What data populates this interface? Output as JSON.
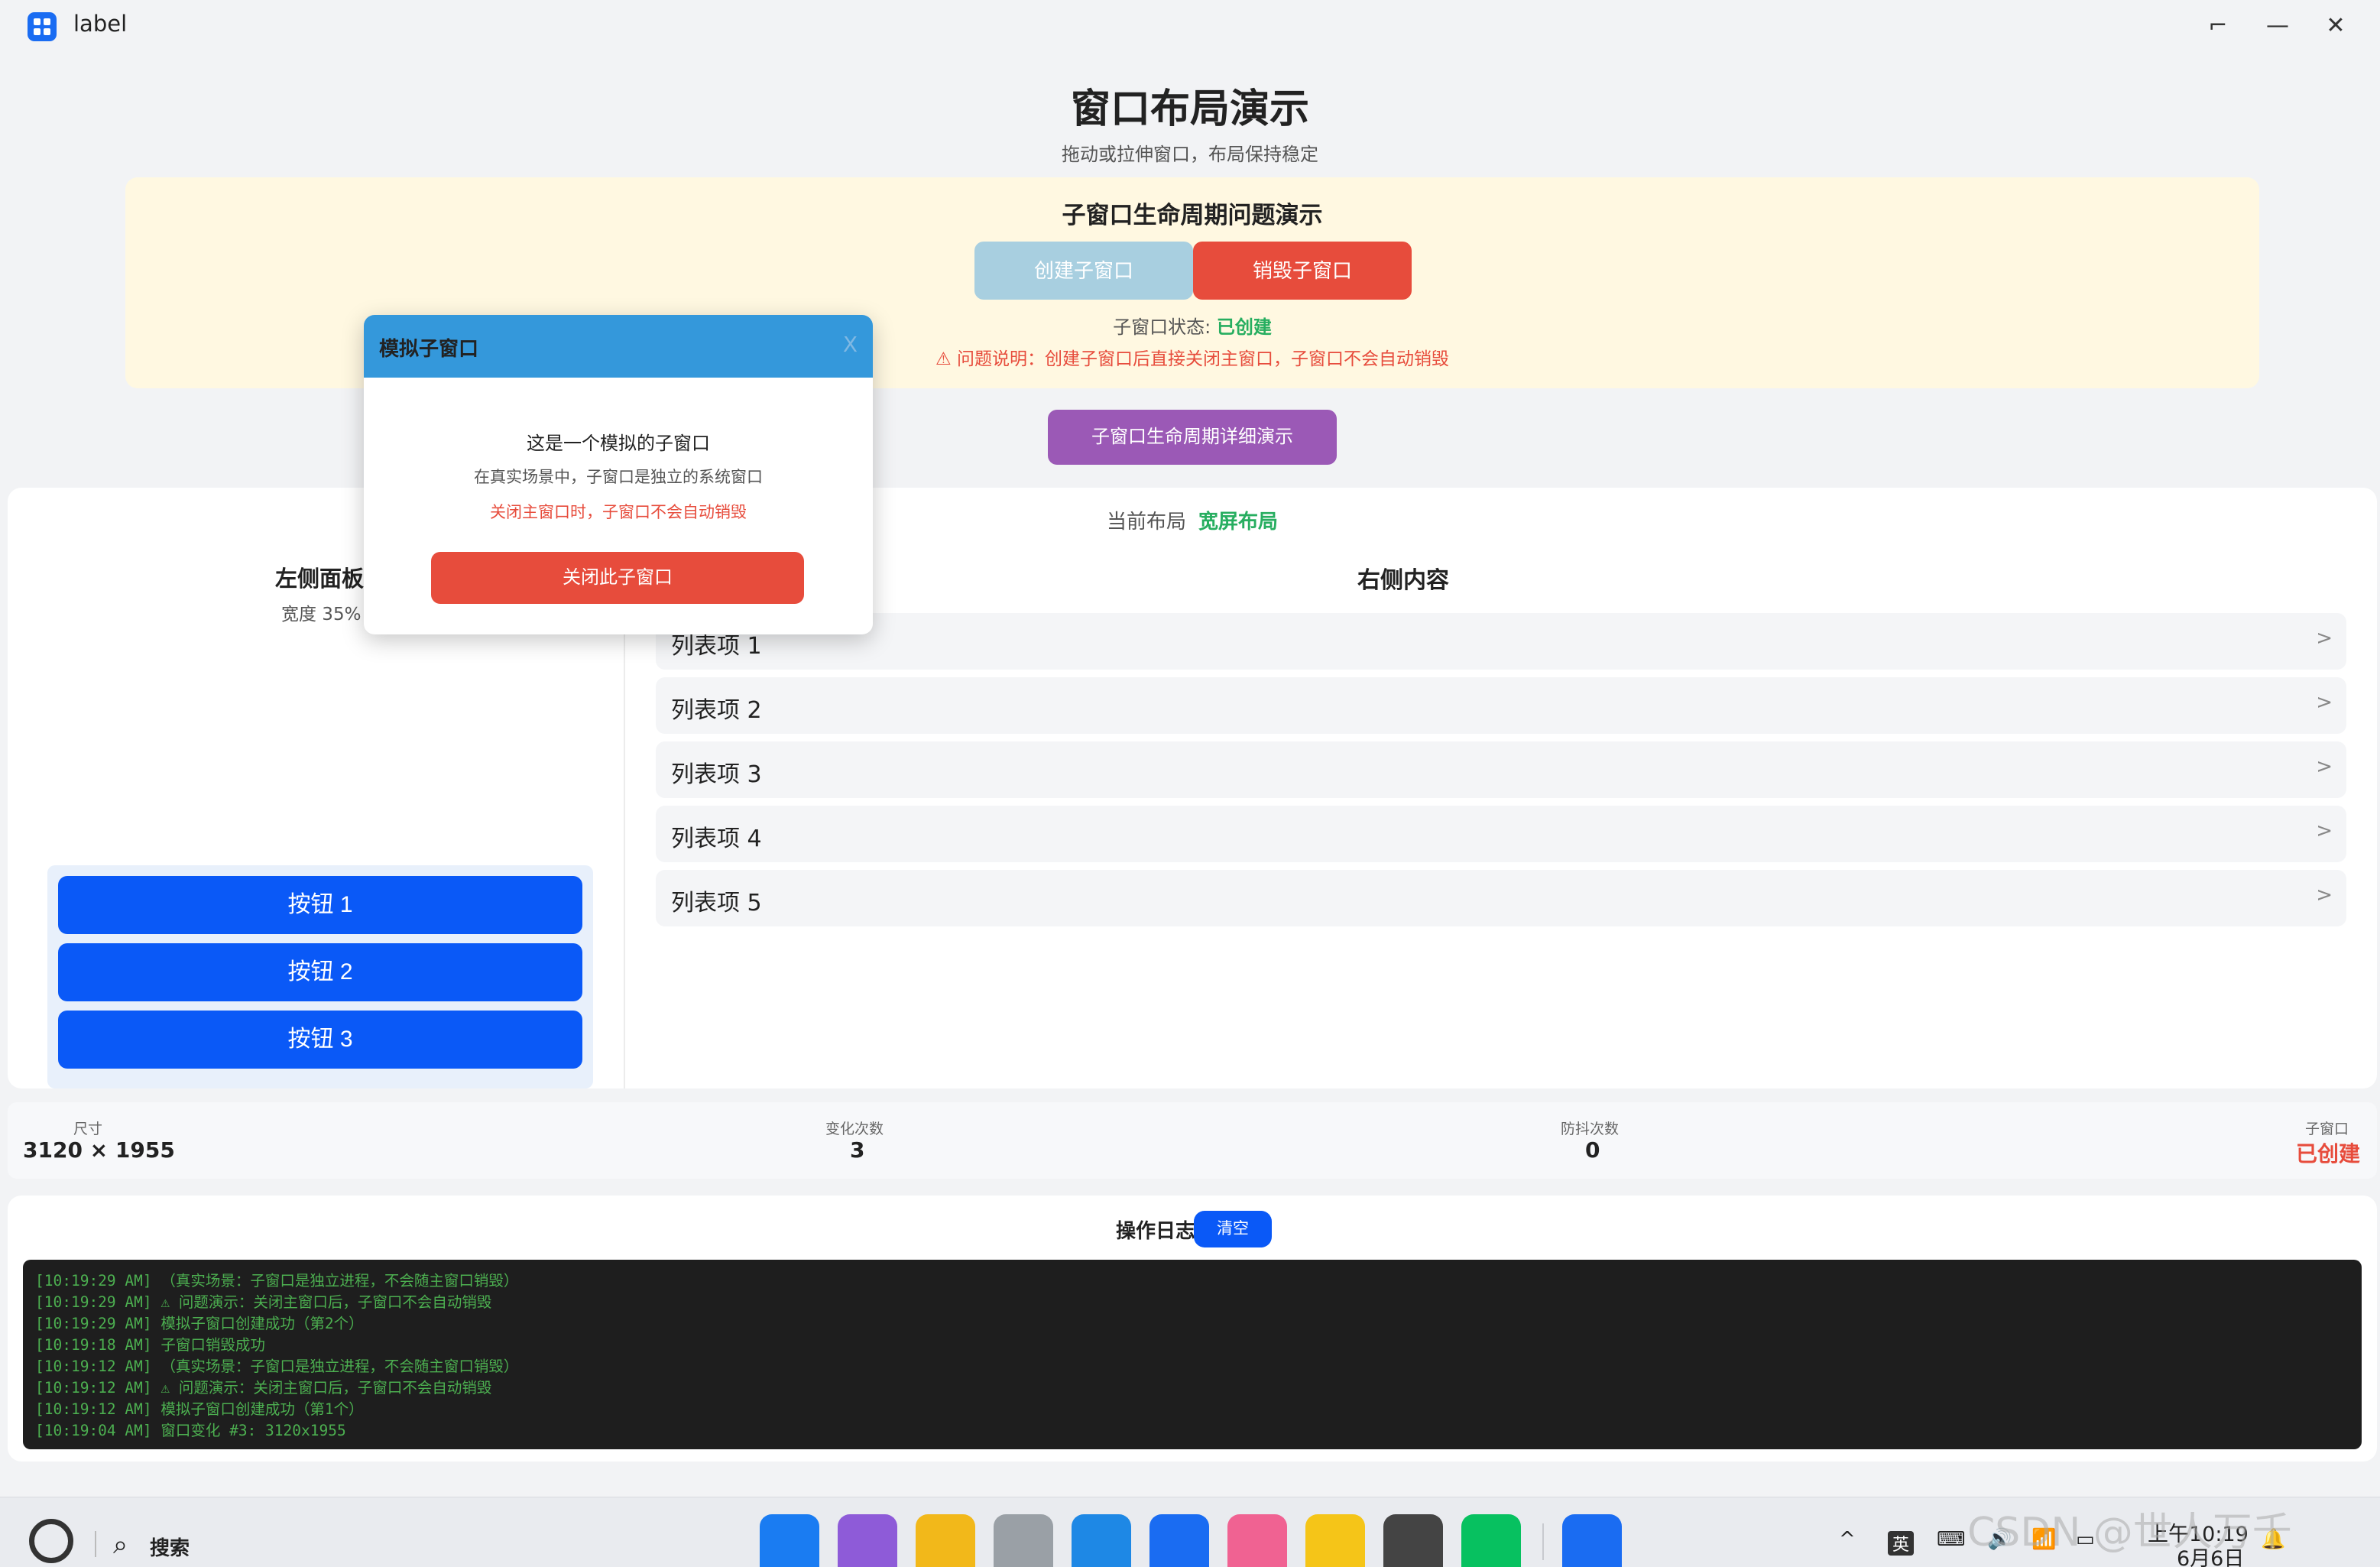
{
  "window": {
    "title": "label",
    "controls": {
      "restore": "⌐",
      "minimize": "—",
      "close": "✕"
    }
  },
  "header": {
    "title": "窗口布局演示",
    "subtitle": "拖动或拉伸窗口，布局保持稳定"
  },
  "lifecycle": {
    "title": "子窗口生命周期问题演示",
    "create_label": "创建子窗口",
    "destroy_label": "销毁子窗口",
    "status_prefix": "子窗口状态: ",
    "status_value": "已创建",
    "warning": "⚠ 问题说明：创建子窗口后直接关闭主窗口，子窗口不会自动销毁"
  },
  "detail_button": "子窗口生命周期详细演示",
  "layout": {
    "label": "当前布局",
    "value": "宽屏布局"
  },
  "left_panel": {
    "title": "左侧面板",
    "width": "宽度 35%",
    "buttons": [
      "按钮 1",
      "按钮 2",
      "按钮 3"
    ]
  },
  "right_panel": {
    "title": "右侧内容",
    "items": [
      "列表项 1",
      "列表项 2",
      "列表项 3",
      "列表项 4",
      "列表项 5"
    ],
    "chevron": ">"
  },
  "stats": {
    "size_label": "尺寸",
    "size_value": "3120 × 1955",
    "changes_label": "变化次数",
    "changes_value": "3",
    "debounce_label": "防抖次数",
    "debounce_value": "0",
    "child_label": "子窗口",
    "child_value": "已创建"
  },
  "log": {
    "title": "操作日志",
    "clear_label": "清空",
    "lines": [
      "[10:19:29 AM] （真实场景：子窗口是独立进程，不会随主窗口销毁）",
      "[10:19:29 AM] ⚠ 问题演示：关闭主窗口后，子窗口不会自动销毁",
      "[10:19:29 AM] 模拟子窗口创建成功（第2个）",
      "[10:19:18 AM] 子窗口销毁成功",
      "[10:19:12 AM] （真实场景：子窗口是独立进程，不会随主窗口销毁）",
      "[10:19:12 AM] ⚠ 问题演示：关闭主窗口后，子窗口不会自动销毁",
      "[10:19:12 AM] 模拟子窗口创建成功（第1个）",
      "[10:19:04 AM] 窗口变化 #3: 3120x1955"
    ]
  },
  "popup": {
    "title": "模拟子窗口",
    "close_x": "X",
    "line1": "这是一个模拟的子窗口",
    "line2": "在真实场景中，子窗口是独立的系统窗口",
    "line3": "关闭主窗口时，子窗口不会自动销毁",
    "close_button": "关闭此子窗口"
  },
  "taskbar": {
    "search": "搜索",
    "search_icon": "search-icon",
    "dock": [
      {
        "name": "app-grid",
        "color": "#1a7cf2"
      },
      {
        "name": "gallery",
        "color": "#8e5bd8"
      },
      {
        "name": "files",
        "color": "#f2b81a"
      },
      {
        "name": "recycle-bin",
        "color": "#9aa0a6"
      },
      {
        "name": "browser",
        "color": "#1e88e5"
      },
      {
        "name": "mail",
        "color": "#1a6cf2"
      },
      {
        "name": "photos",
        "color": "#f06292"
      },
      {
        "name": "notes",
        "color": "#f5c518"
      },
      {
        "name": "settings",
        "color": "#444444"
      },
      {
        "name": "wechat",
        "color": "#07c160"
      },
      {
        "name": "label-app",
        "color": "#1a6cf2"
      }
    ],
    "tray_caret": "^",
    "ime": "英",
    "time": "上午10:19",
    "date": "6月6日",
    "watermark": "CSDN @世人万千"
  }
}
